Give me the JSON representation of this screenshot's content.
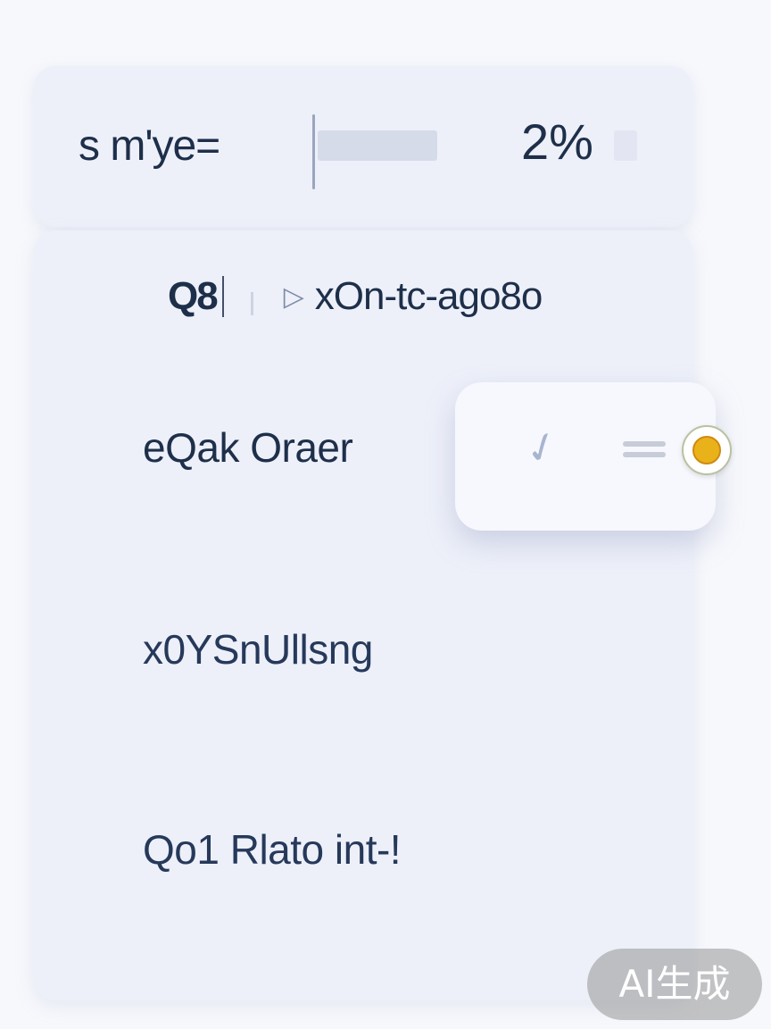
{
  "top_panel": {
    "label": "s m'ye=",
    "percent": "2%"
  },
  "search": {
    "icon_text": "Q8",
    "icon": "search-icon",
    "play_icon": "play-icon",
    "text": "xOn-tc-ago8o"
  },
  "menu": {
    "items": [
      {
        "label": "eQak Oraer"
      },
      {
        "label": "x0YSnUllsng"
      },
      {
        "label": "Qo1 Rlato int-!"
      }
    ]
  },
  "popover": {
    "icon": "pen-icon",
    "menu_icon": "menu-icon",
    "avatar": "avatar"
  },
  "watermark": {
    "text": "AI生成"
  }
}
